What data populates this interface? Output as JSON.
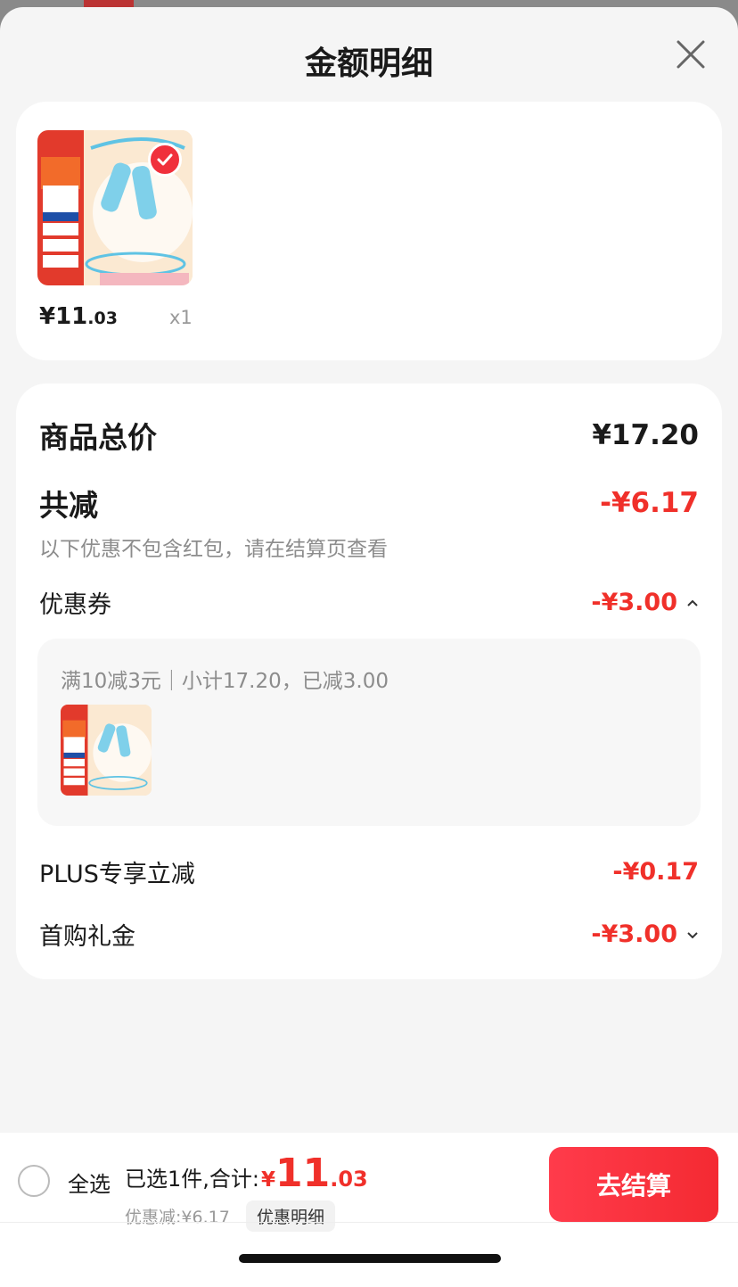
{
  "sheet": {
    "title": "金额明细"
  },
  "product": {
    "price_main": "¥11",
    "price_dec": ".03",
    "quantity": "x1"
  },
  "summary": {
    "total_label": "商品总价",
    "total_value": "¥17.20",
    "discount_label": "共减",
    "discount_value": "-¥6.17",
    "note": "以下优惠不包含红包，请在结算页查看",
    "coupon_label": "优惠券",
    "coupon_value": "-¥3.00",
    "coupon_detail": "满10减3元｜小计17.20，已减3.00",
    "plus_label": "PLUS专享立减",
    "plus_value": "-¥0.17",
    "gift_label": "首购礼金",
    "gift_value": "-¥3.00"
  },
  "bottom_bar": {
    "select_all": "全选",
    "selected_text": "已选1件,合计:",
    "currency": "¥",
    "total_big": "11",
    "total_dec": ".03",
    "savings": "优惠减:¥6.17",
    "detail_button": "优惠明细",
    "checkout_button": "去结算"
  },
  "colors": {
    "accent": "#f0302a",
    "button": "#f42a32",
    "background": "#f5f5f5"
  },
  "icons": {
    "close": "close-icon",
    "check": "check-icon",
    "caret_up": "caret-up-icon",
    "caret_down": "caret-down-icon"
  }
}
